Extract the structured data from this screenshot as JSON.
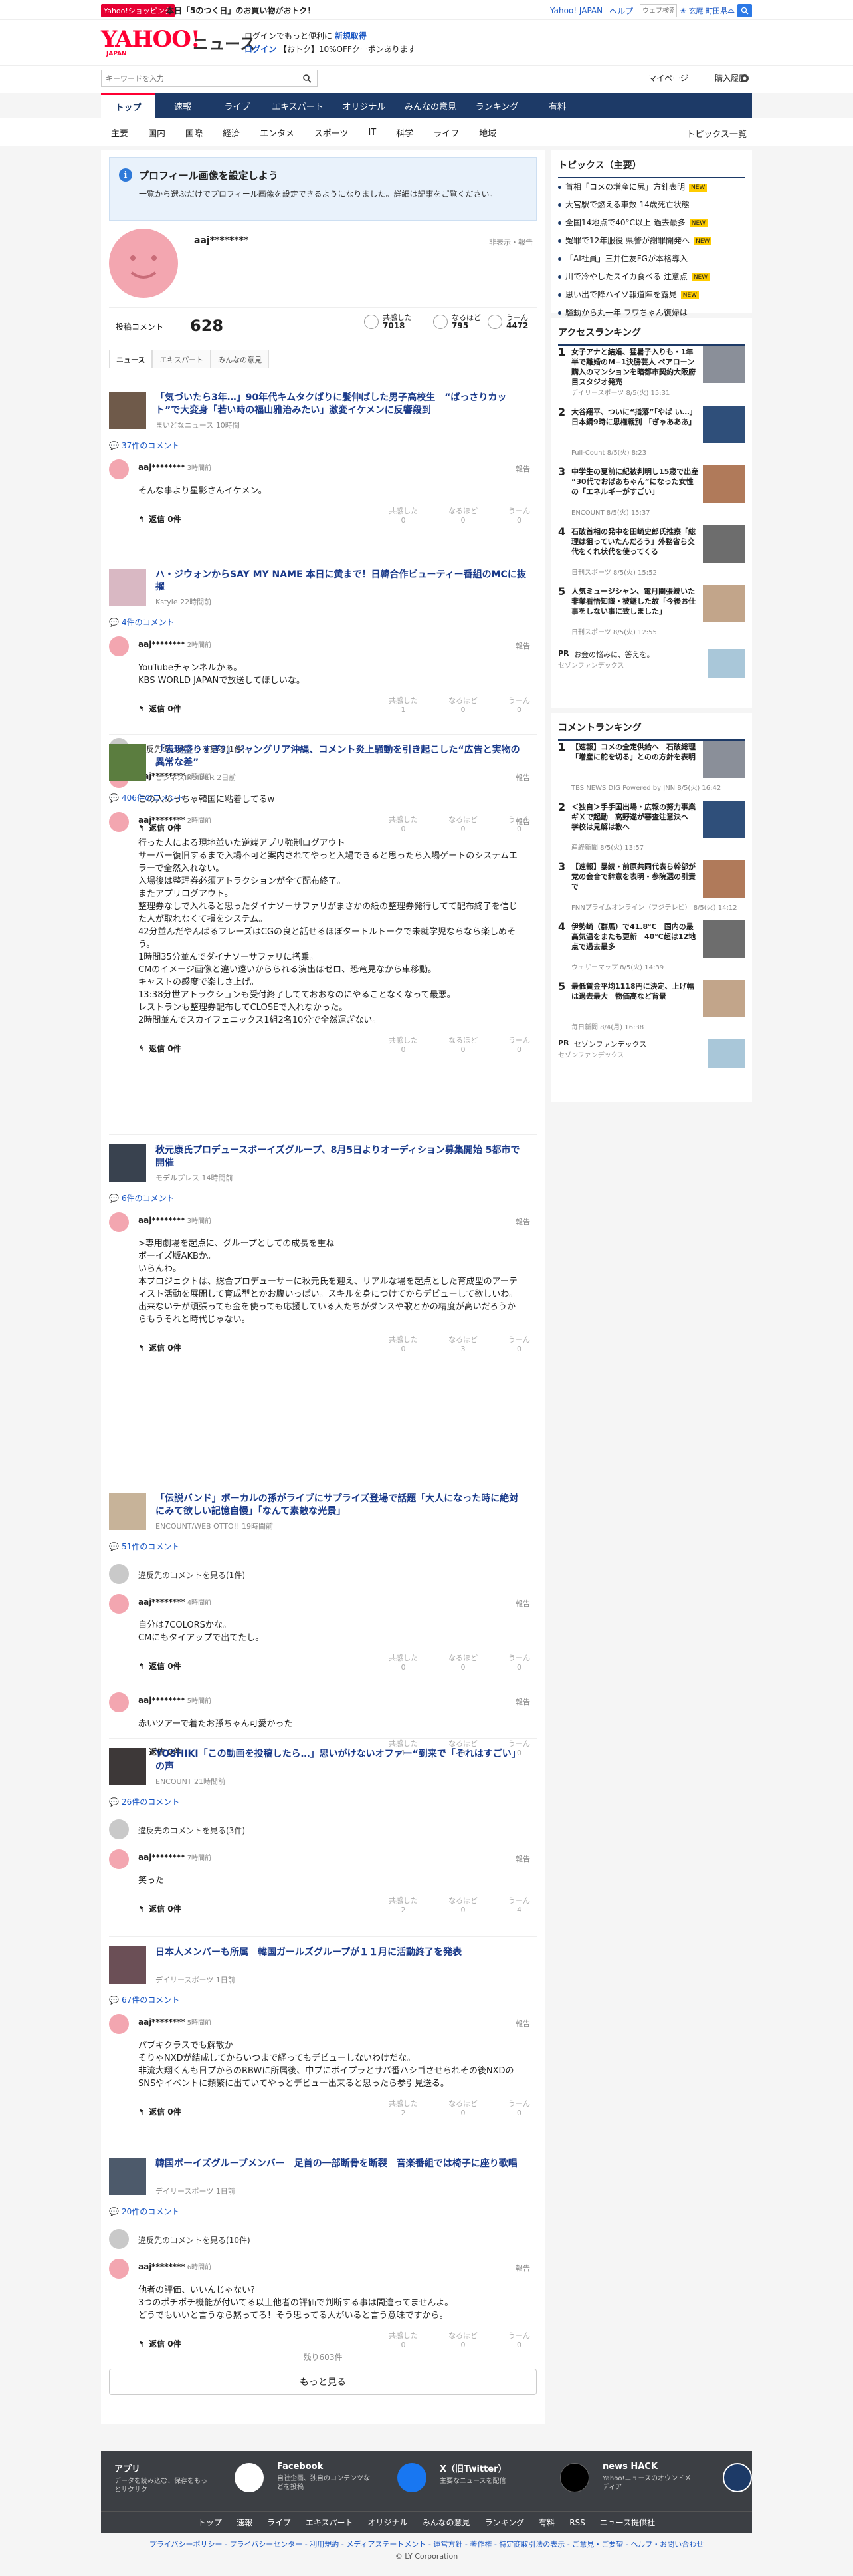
{
  "topbar": {
    "shop_badge": "Yahoo!ショッピング",
    "shop_text": "本日「5のつく日」のお買い物がおトク！",
    "yahoo_japan": "Yahoo! JAPAN",
    "help": "ヘルプ",
    "weather_placeholder": "ウェブ検索",
    "location": "☀ 玄庵 町田県本"
  },
  "header": {
    "logo": "YAHOO!",
    "logo_sub": "JAPAN",
    "news": "ニュース",
    "promo_line1": "ログインでもっと便利に",
    "promo_new": "新規取得",
    "promo_line2_login": "ログイン",
    "promo_line2": "【おトク】10%OFFクーポンあります"
  },
  "search": {
    "placeholder": "キーワードを入力",
    "mypage": "マイページ",
    "history": "購入履歴"
  },
  "gnav": [
    "トップ",
    "速報",
    "ライブ",
    "エキスパート",
    "オリジナル",
    "みんなの意見",
    "ランキング",
    "有料"
  ],
  "subnav": [
    "主要",
    "国内",
    "国際",
    "経済",
    "エンタメ",
    "スポーツ",
    "IT",
    "科学",
    "ライフ",
    "地域"
  ],
  "topics_all": "トピックス一覧",
  "notice": {
    "title": "プロフィール画像を設定しよう",
    "desc": "一覧から選ぶだけでプロフィール画像を設定できるようになりました。詳細は記事をご覧ください。"
  },
  "profile": {
    "name": "aaj********",
    "report": "非表示・報告"
  },
  "posts": {
    "label": "投稿コメント",
    "count": "628",
    "r1_label": "共感した",
    "r1_value": "7018",
    "r2_label": "なるほど",
    "r2_value": "795",
    "r3_label": "うーん",
    "r3_value": "4472"
  },
  "tabs": [
    "ニュース",
    "エキスパート",
    "みんなの意見"
  ],
  "articles": [
    {
      "title": "「気づいたら3年…」90年代キムタクばりに髪伸ばした男子高校生　“ばっさりカット”で大変身「若い時の福山雅治みたい」激変イケメンに反響殺到",
      "source": "まいどなニュース 10時間",
      "count": "37件のコメント",
      "comments": [
        {
          "name": "aaj********",
          "time": "3時間前",
          "text": "そんな事より星影さんイケメン。",
          "reply": "返信 0件",
          "r": [
            "0",
            "0",
            "0"
          ]
        }
      ]
    },
    {
      "title": "ハ・ジウォンからSAY MY NAME 本日に黄まで！日韓合作ビューティー番組のMCに抜擢",
      "source": "Kstyle 22時間前",
      "count": "4件のコメント",
      "comments": [
        {
          "name": "aaj********",
          "time": "2時間前",
          "text": "YouTubeチャンネルかぁ。\nKBS WORLD JAPANで放送してほしいな。",
          "reply": "返信 0件",
          "r": [
            "1",
            "0",
            "0"
          ]
        },
        {
          "name": "aaj********",
          "time": "2時間前",
          "text": "この人めっちゃ韓国に粘着してるw",
          "reply": "返信 0件",
          "r": [
            "0",
            "0",
            "0"
          ]
        }
      ],
      "hidden": "違反先のコメントを見る(1件)"
    },
    {
      "title": "「表現盛りすぎ?」ジャングリア沖縄、コメント炎上騒動を引き起こした“広告と実物の異常な差”",
      "source": "ビジネスINSIDER 2日前",
      "count": "406件のコメント",
      "comments": [
        {
          "name": "aaj********",
          "time": "2時間前",
          "text": "行った人による現地並いた逆端アプリ強制ログアウト\nサーバー復旧するまで入場不可と案内されてやっと入場できると思ったら入場ゲートのシステムエラーで全然入れない。\n入場後は整理券必須アトラクションが全て配布終了。\nまたアプリログアウト。\n整理券なしで入れると思ったダイナソーサファリがまさかの紙の整理券発行してて配布終了を信じた人が取れなくて損をシステム。\n42分並んだやんばるフレーズはCGの良と話せるほぼタートルトークで未就学児ならなら楽しめそう。\n1時間35分並んでダイナソーサファリに搭乗。\nCMのイメージ画像と違い遠いからられる演出はゼロ、恐竜見なから車移動。\nキャストの感度で楽しさ上げ。\n13:38分世アトラクションも受付終了してておおなのにやることなくなって最悪。\nレストランも整理券配布してCLOSEで入れなかった。\n2時間並んでスカイフェニックス1組2名10分で全然運ぎない。",
          "reply": "返信 0件",
          "r": [
            "0",
            "0",
            "0"
          ]
        }
      ]
    },
    {
      "title": "秋元康氏プロデュースボーイズグループ、8月5日よりオーディション募集開始 5都市で開催",
      "source": "モデルプレス 14時間前",
      "count": "6件のコメント",
      "comments": [
        {
          "name": "aaj********",
          "time": "3時間前",
          "text": ">専用劇場を起点に、グループとしての成長を重ね\nボーイズ版AKBか。\nいらんわ。\n本プロジェクトは、総合プロデューサーに秋元氏を迎え、リアルな場を起点とした育成型のアーティスト活動を展開して育成型とかお腹いっぱい。スキルを身につけてからデビューして欲しいわ。\n出来ないチが頑張っても金を使っても応援している人たちがダンスや歌とかの精度が高いだろうからもうそれと時代じゃない。",
          "reply": "返信 0件",
          "r": [
            "0",
            "3",
            "0"
          ]
        }
      ]
    },
    {
      "title": "「伝説バンド」ボーカルの孫がライブにサプライズ登場で話題「大人になった時に絶対にみて欲しい記憶自慢」「なんて素敵な光景」",
      "source": "ENCOUNT/WEB OTTO!! 19時間前",
      "count": "51件のコメント",
      "comments": [
        {
          "name": "aaj********",
          "time": "4時間前",
          "text": "自分は7COLORSかな。\nCMにもタイアップで出てたし。",
          "reply": "返信 0件",
          "r": [
            "0",
            "0",
            "0"
          ]
        },
        {
          "name": "aaj********",
          "time": "5時間前",
          "text": "赤いツアーで着たお孫ちゃん可愛かった",
          "reply": "返信 0件",
          "r": [
            "1",
            "0",
            "0"
          ]
        }
      ],
      "hidden": "違反先のコメントを見る(1件)"
    },
    {
      "title": "YOSHIKI「この動画を投稿したら…」思いがけないオファー“到来で「それはすごい」の声",
      "source": "ENCOUNT 21時間前",
      "count": "26件のコメント",
      "comments": [
        {
          "name": "aaj********",
          "time": "7時間前",
          "text": "笑った",
          "reply": "返信 0件",
          "r": [
            "2",
            "0",
            "4"
          ]
        }
      ],
      "hidden": "違反先のコメントを見る(3件)"
    },
    {
      "title": "日本人メンバーも所属　韓国ガールズグループが１１月に活動終了を発表",
      "source": "デイリースポーツ 1日前",
      "count": "67件のコメント",
      "comments": [
        {
          "name": "aaj********",
          "time": "5時間前",
          "text": "パブキクラスでも解散か\nそりゃNXDが結成してからいつまで経ってもデビューしないわけだな。\n非流大翔くんも日プからのRBWに所属後、中プにボイプラとサバ番ハシゴさせられその後NXDのSNSやイベントに頻繁に出ていてやっとデビュー出来ると思ったら参引見送る。",
          "reply": "返信 0件",
          "r": [
            "2",
            "0",
            "0"
          ]
        }
      ]
    },
    {
      "title": "韓国ボーイズグループメンバー　足首の一部断骨を断裂　音楽番組では椅子に座り歌唱",
      "source": "デイリースポーツ 1日前",
      "count": "20件のコメント",
      "comments": [
        {
          "name": "aaj********",
          "time": "6時間前",
          "text": "他者の評価、いいんじゃない?\n3つのポチポチ機能が付いてる以上他者の評価で判断する事は間違ってませんよ。\nどうでもいいと言うなら黙ってろ！そう思ってる人がいると言う意味ですから。",
          "reply": "返信 0件",
          "r": [
            "0",
            "0",
            "0"
          ]
        }
      ],
      "hidden": "違反先のコメントを見る(10件)"
    }
  ],
  "report_label": "報告",
  "react_labels": [
    "共感した",
    "なるほど",
    "うーん"
  ],
  "more_count": "残り603件",
  "more_button": "もっと見る",
  "side": {
    "topics_title": "トピックス（主要）",
    "topics": [
      {
        "t": "首相「コメの増産に尻」方針表明",
        "new": "NEW"
      },
      {
        "t": "大宮駅で燃える車数 14歳死亡状態",
        "new": ""
      },
      {
        "t": "全国14地点で40°C以上 過去最多",
        "new": "NEW"
      },
      {
        "t": "冤罪で12年服役 県警が謝罪開発へ",
        "new": "NEW"
      },
      {
        "t": "「AI社員」三井住友FGが本格導入",
        "new": ""
      },
      {
        "t": "川で冷やしたスイカ食べる 注意点",
        "new": "NEW"
      },
      {
        "t": "思い出で降ハイソ報道陣を露見",
        "new": "NEW"
      },
      {
        "t": "騒動から丸一年 フワちゃん復帰は",
        "new": ""
      }
    ],
    "access_title": "アクセスランキング",
    "access": [
      {
        "no": "1",
        "t": "女子アナと結婚、猛暑子入りも・1年半で離婚のM−1決勝芸人 ペアローン購入のマンションを暗都市契約大阪府目スタジオ発売",
        "s": "デイリースポーツ 8/5(火) 15:31"
      },
      {
        "no": "2",
        "t": "大谷翔平、ついに“指落”「やば い…」日本鋼9時に思権戦別 「ぎゃあああ」",
        "s": "Full-Count 8/5(火) 8:23"
      },
      {
        "no": "3",
        "t": "中学生の夏前に紀被判明し15歳で出産 “30代でおばあちゃん”になった女性の「エネルギーがすごい」",
        "s": "ENCOUNT 8/5(火) 15:37"
      },
      {
        "no": "4",
        "t": "石破首相の発中を田崎史郎氏推察「総理は狙っていたんだろう」外務省ら交代をくれ状代を使ってくる",
        "s": "日刊スポーツ 8/5(火) 15:52"
      },
      {
        "no": "5",
        "t": "人気ミュージシャン、電月関張続いた非業看悟知識・被継した故「今後お仕事をしない事に致しました」",
        "s": "日刊スポーツ 8/5(火) 12:55"
      }
    ],
    "pr1_tag": "PR",
    "pr1_t1": "お金の悩みに、答えを。",
    "pr1_t2": "セゾンファンデックス",
    "comment_title": "コメントランキング",
    "comments": [
      {
        "no": "1",
        "t": "【速報】コメの全定供給へ　石破総理「増産に舵を切る」とのの方針を表明",
        "s": "TBS NEWS DIG Powered by JNN 8/5(火) 16:42"
      },
      {
        "no": "2",
        "t": "＜独自＞手手国出場・広報の努力事業ギＸで起動　高野遂が審査注意決へ　学校は見解は教へ",
        "s": "産経新聞 8/5(火) 13:57"
      },
      {
        "no": "3",
        "t": "【速報】暴続・前原共同代表ら幹部が党の会合で辞意を表明・参院選の引責で",
        "s": "FNNプライムオンライン（フジテレビ） 8/5(火) 14:12"
      },
      {
        "no": "4",
        "t": "伊勢崎（群馬）で41.8°C　国内の最高気温をまたも更新　40°C超は12地点で過去最多",
        "s": "ウェザーマップ 8/5(火) 14:39"
      },
      {
        "no": "5",
        "t": "最低賃金平均1118円に決定、上げ幅は過去最大　物価高など背景",
        "s": "毎日新聞 8/4(月) 16:38"
      }
    ],
    "pr2_tag": "PR",
    "pr2_t1": "セゾンファンデックス",
    "pr2_t2": "セゾンファンデックス"
  },
  "footer": {
    "apps": [
      {
        "t": "アプリ",
        "d": "データを読み込む、保存をもっとサクサク"
      },
      {
        "t": "Facebook",
        "d": "自社企画、独自のコンテンツなどを投稿"
      },
      {
        "t": "X（旧Twitter）",
        "d": "主要なニュースを配信"
      },
      {
        "t": "news HACK",
        "d": "Yahoo!ニュースのオウンドメディア"
      }
    ],
    "nav": [
      "トップ",
      "速報",
      "ライブ",
      "エキスパート",
      "オリジナル",
      "みんなの意見",
      "ランキング",
      "有料",
      "RSS",
      "ニュース提供社"
    ],
    "links": "プライバシーポリシー - プライバシーセンター - 利用規約 - メディアステートメント - 運営方針 - 著作権 - 特定商取引法の表示 - ご意見・ご要望 - ヘルプ・お問い合わせ",
    "copyright": "© LY Corporation"
  },
  "colors": {
    "brand": "#ff0033",
    "nav": "#1d3a67",
    "link": "#1a3a8a"
  }
}
